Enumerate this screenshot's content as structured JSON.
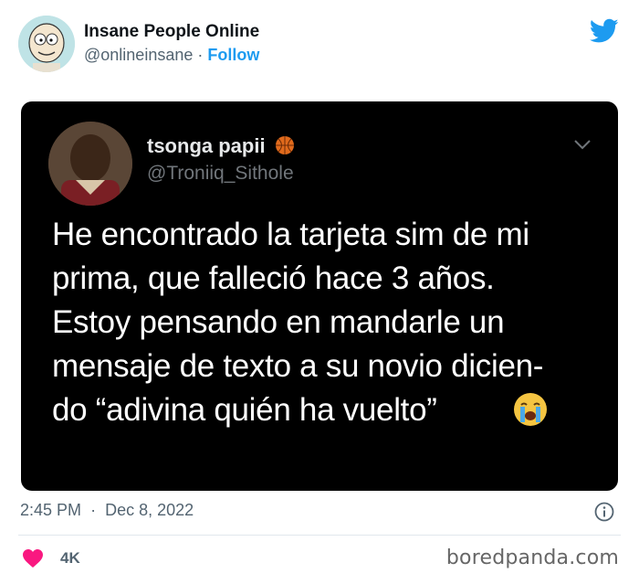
{
  "author": {
    "display_name": "Insane People Online",
    "handle": "@onlineinsane",
    "separator": "·",
    "follow_label": "Follow"
  },
  "embedded_tweet": {
    "display_name": "tsonga papii",
    "handle": "@Troniiq_Sithole",
    "text": "He encontrado la tarjeta sim de mi prima, que falleció hace 3 años. Estoy pensando en mandarle un mensaje de texto a su novio dicien-do “adivina quién ha vuelto”",
    "lines": [
      "He encontrado la tarjeta sim de mi",
      "prima, que falleció hace 3 años.",
      "Estoy pensando en mandarle un",
      "mensaje de texto a su novio dicien-",
      "do “adivina quién ha vuelto”"
    ]
  },
  "meta": {
    "time": "2:45 PM",
    "separator": "·",
    "date": "Dec 8, 2022"
  },
  "engagement": {
    "likes": "4K"
  },
  "watermark": "boredpanda.com",
  "colors": {
    "twitter_blue": "#1d9bf0",
    "like_red": "#f91880",
    "card_bg": "#000000"
  },
  "icons": [
    "twitter-bird-icon",
    "chevron-down-icon",
    "info-icon",
    "heart-icon",
    "crying-face-emoji",
    "basketball-emoji"
  ]
}
